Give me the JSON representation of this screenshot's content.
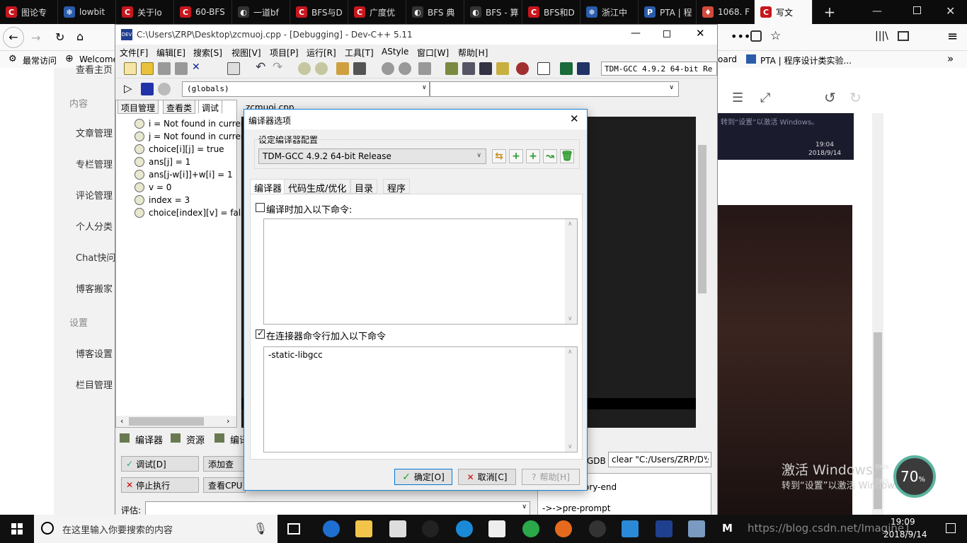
{
  "browser": {
    "tabs": [
      {
        "label": "图论专",
        "color": "#c8161d",
        "glyph": "C"
      },
      {
        "label": "lowbit",
        "color": "#2a5caa",
        "glyph": "❄"
      },
      {
        "label": "关于lo",
        "color": "#c8161d",
        "glyph": "C"
      },
      {
        "label": "60-BFS",
        "color": "#c8161d",
        "glyph": "C"
      },
      {
        "label": "一道bf",
        "color": "#333333",
        "glyph": "◐"
      },
      {
        "label": "BFS与D",
        "color": "#c8161d",
        "glyph": "C"
      },
      {
        "label": "广度优",
        "color": "#c8161d",
        "glyph": "C"
      },
      {
        "label": "BFS 典",
        "color": "#333333",
        "glyph": "◐"
      },
      {
        "label": "BFS - 算",
        "color": "#333333",
        "glyph": "◐"
      },
      {
        "label": "BFS和D",
        "color": "#c8161d",
        "glyph": "C"
      },
      {
        "label": "浙江中",
        "color": "#2a5caa",
        "glyph": "❄"
      },
      {
        "label": "PTA | 程",
        "color": "#2a5caa",
        "glyph": "P"
      },
      {
        "label": "1068. F",
        "color": "#d24a3a",
        "glyph": "♦"
      },
      {
        "label": "写文",
        "color": "#c8161d",
        "glyph": "C"
      }
    ],
    "bookmarks": {
      "frequent": "最常访问",
      "welcome": "Welcome",
      "board": "oard",
      "pta": "PTA | 程序设计类实验..."
    }
  },
  "webpage": {
    "top_partial": "查看主页",
    "section_content": "内容",
    "items_content": [
      "文章管理",
      "专栏管理",
      "评论管理",
      "个人分类",
      "Chat快问",
      "博客搬家"
    ],
    "section_settings": "设置",
    "items_settings": [
      "博客设置",
      "栏目管理"
    ],
    "activate_title": "激活 Windows",
    "activate_sub": "转到“设置”以激活 Windows。",
    "screenshot_date": "2018/9/14",
    "screenshot_time": "19:04"
  },
  "devcpp": {
    "title": "C:\\Users\\ZRP\\Desktop\\zcmuoj.cpp - [Debugging] - Dev-C++ 5.11",
    "menu": [
      "文件[F]",
      "编辑[E]",
      "搜索[S]",
      "视图[V]",
      "项目[P]",
      "运行[R]",
      "工具[T]",
      "AStyle",
      "窗口[W]",
      "帮助[H]"
    ],
    "compiler_selector": "TDM-GCC 4.9.2 64-bit Re",
    "globals": "(globals)",
    "panel_tabs": [
      "项目管理",
      "查看类",
      "调试"
    ],
    "watches": [
      "i = Not found in current",
      "j = Not found in current",
      "choice[i][j] = true",
      "ans[j] = 1",
      "ans[j-w[i]]+w[i] = 1",
      "v = 0",
      "index = 3",
      "choice[index][v] = false"
    ],
    "editor_tab": "zcmuoj.cpp",
    "bottom_tabs": [
      "编译器",
      "资源",
      "编译"
    ],
    "debug_button": "调试[D]",
    "add_watch_button": "添加查",
    "stop_button": "停止执行",
    "view_cpu_button": "查看CPU",
    "evaluate_label": "评估:",
    "gdb_label": "GDB :",
    "gdb_value": "clear \"C:/Users/ZRP/De",
    "log_lines": [
      "value-history-end",
      "->->pre-prompt"
    ]
  },
  "dialog": {
    "title": "编译器选项",
    "config_label": "设定编译器配置",
    "config_value": "TDM-GCC 4.9.2 64-bit Release",
    "tabs": [
      "编译器",
      "代码生成/优化",
      "目录",
      "程序"
    ],
    "compile_check_label": "编译时加入以下命令:",
    "compile_checked": false,
    "compile_commands": "",
    "linker_check_label": "在连接器命令行加入以下命令",
    "linker_checked": true,
    "linker_commands": "-static-libgcc",
    "ok_button": "确定[O]",
    "cancel_button": "取消[C]",
    "help_button": "帮助[H]"
  },
  "widget": {
    "percent": "70",
    "unit": "%",
    "net_up": "0K/s",
    "net_down": "0K/s"
  },
  "taskbar": {
    "search_placeholder": "在这里输入你要搜索的内容",
    "time": "19:09",
    "date": "2018/9/14",
    "watermark": "https://blog.csdn.net/Imagine1"
  }
}
